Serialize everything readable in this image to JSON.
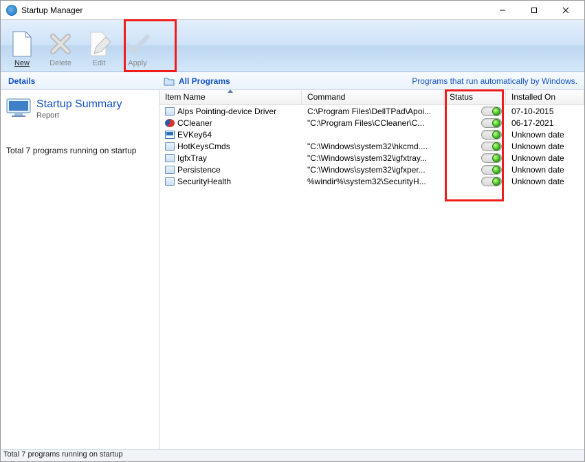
{
  "window": {
    "title": "Startup Manager"
  },
  "toolbar": {
    "new": "New",
    "delete": "Delete",
    "edit": "Edit",
    "apply": "Apply"
  },
  "section": {
    "details": "Details",
    "all_programs": "All Programs",
    "hint": "Programs that run automatically by Windows."
  },
  "sidebar": {
    "summary_title": "Startup Summary",
    "summary_sub": "Report",
    "summary_count": "Total 7 programs running on startup"
  },
  "columns": {
    "name": "Item Name",
    "command": "Command",
    "status": "Status",
    "installed": "Installed On"
  },
  "rows": [
    {
      "icon": "app",
      "name": "Alps Pointing-device Driver",
      "command": "C:\\Program Files\\DellTPad\\Apoi...",
      "status": "on",
      "installed": "07-10-2015"
    },
    {
      "icon": "ccleaner",
      "name": "CCleaner",
      "command": "\"C:\\Program Files\\CCleaner\\C...",
      "status": "on",
      "installed": "06-17-2021"
    },
    {
      "icon": "evkey",
      "name": "EVKey64",
      "command": "",
      "status": "on",
      "installed": "Unknown date"
    },
    {
      "icon": "app",
      "name": "HotKeysCmds",
      "command": "\"C:\\Windows\\system32\\hkcmd....",
      "status": "on",
      "installed": "Unknown date"
    },
    {
      "icon": "app",
      "name": "IgfxTray",
      "command": "\"C:\\Windows\\system32\\igfxtray...",
      "status": "on",
      "installed": "Unknown date"
    },
    {
      "icon": "app",
      "name": "Persistence",
      "command": "\"C:\\Windows\\system32\\igfxper...",
      "status": "on",
      "installed": "Unknown date"
    },
    {
      "icon": "app",
      "name": "SecurityHealth",
      "command": "%windir%\\system32\\SecurityH...",
      "status": "on",
      "installed": "Unknown date"
    }
  ],
  "statusbar": "Total 7 programs running on startup"
}
